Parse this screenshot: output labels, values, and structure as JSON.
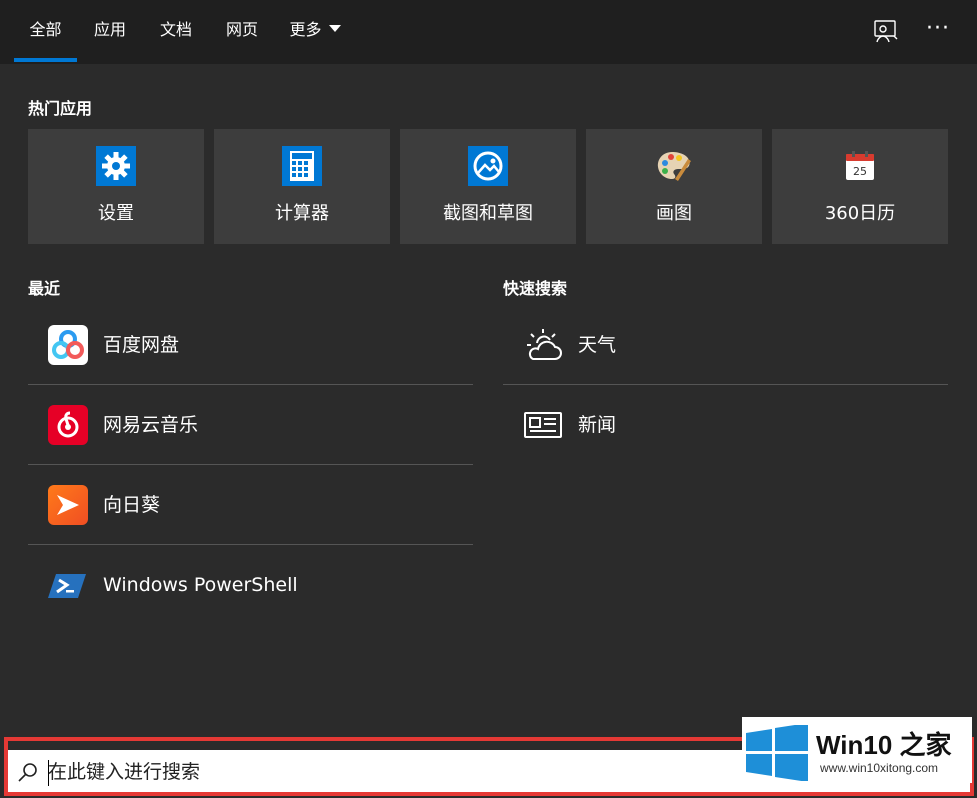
{
  "tabs": {
    "all": "全部",
    "apps": "应用",
    "docs": "文档",
    "web": "网页",
    "more": "更多"
  },
  "top_apps": {
    "title": "热门应用",
    "items": [
      {
        "label": "设置",
        "icon": "gear-icon"
      },
      {
        "label": "计算器",
        "icon": "calculator-icon"
      },
      {
        "label": "截图和草图",
        "icon": "snip-sketch-icon"
      },
      {
        "label": "画图",
        "icon": "paint-palette-icon"
      },
      {
        "label": "360日历",
        "icon": "calendar-icon",
        "day": "25"
      }
    ]
  },
  "recent": {
    "title": "最近",
    "items": [
      {
        "label": "百度网盘",
        "icon": "baidu-netdisk-icon"
      },
      {
        "label": "网易云音乐",
        "icon": "netease-music-icon"
      },
      {
        "label": "向日葵",
        "icon": "sunlogin-icon"
      },
      {
        "label": "Windows PowerShell",
        "icon": "powershell-icon"
      }
    ]
  },
  "quick": {
    "title": "快速搜索",
    "items": [
      {
        "label": "天气",
        "icon": "weather-icon"
      },
      {
        "label": "新闻",
        "icon": "news-icon"
      }
    ]
  },
  "search": {
    "placeholder": "在此键入进行搜索"
  },
  "watermark": {
    "title": "Win10 之家",
    "url": "www.win10xitong.com"
  },
  "colors": {
    "accent": "#0078d4",
    "panel_bg": "#2b2b2b",
    "tile_bg": "#3d3d3d",
    "highlight_border": "#e53935"
  }
}
